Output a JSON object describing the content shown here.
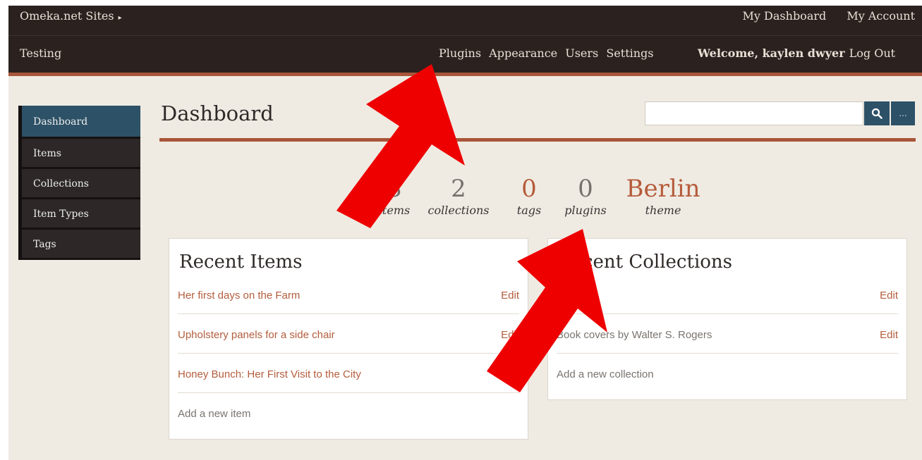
{
  "topbar": {
    "sites_label": "Omeka.net Sites",
    "dashboard_link": "My Dashboard",
    "account_link": "My Account"
  },
  "navbar": {
    "site_name": "Testing",
    "links": [
      "Plugins",
      "Appearance",
      "Users",
      "Settings"
    ],
    "welcome": "Welcome, kaylen dwyer",
    "logout": "Log Out"
  },
  "sidebar": {
    "items": [
      {
        "label": "Dashboard",
        "active": true
      },
      {
        "label": "Items"
      },
      {
        "label": "Collections"
      },
      {
        "label": "Item Types"
      },
      {
        "label": "Tags"
      }
    ]
  },
  "page": {
    "title": "Dashboard"
  },
  "search": {
    "placeholder": "",
    "submit_icon": "search-icon",
    "more_label": "..."
  },
  "stats": [
    {
      "value": "3",
      "label": "items"
    },
    {
      "value": "2",
      "label": "collections"
    },
    {
      "value": "0",
      "label": "tags",
      "accent": true
    },
    {
      "value": "0",
      "label": "plugins"
    },
    {
      "value": "Berlin",
      "label": "theme",
      "accent": true
    }
  ],
  "recent_items": {
    "title": "Recent Items",
    "rows": [
      {
        "title": "Her first days on the Farm",
        "edit": "Edit"
      },
      {
        "title": "Upholstery panels for a side chair",
        "edit": "Edit"
      },
      {
        "title": "Honey Bunch: Her First Visit to the City",
        "edit": ""
      }
    ],
    "add_label": "Add a new item"
  },
  "recent_collections": {
    "title": "Recent Collections",
    "rows": [
      {
        "title": "",
        "edit": "Edit"
      },
      {
        "title": "Book covers by Walter S. Rogers",
        "edit": "Edit"
      }
    ],
    "add_label": "Add a new collection"
  },
  "colors": {
    "topbar_bg": "#2b2220",
    "accent_rust": "#a8553a",
    "sidebar_active": "#2d5167",
    "sidebar_bg": "#2d2827",
    "link_color": "#b35d3c",
    "arrow_red": "#ee0000"
  }
}
